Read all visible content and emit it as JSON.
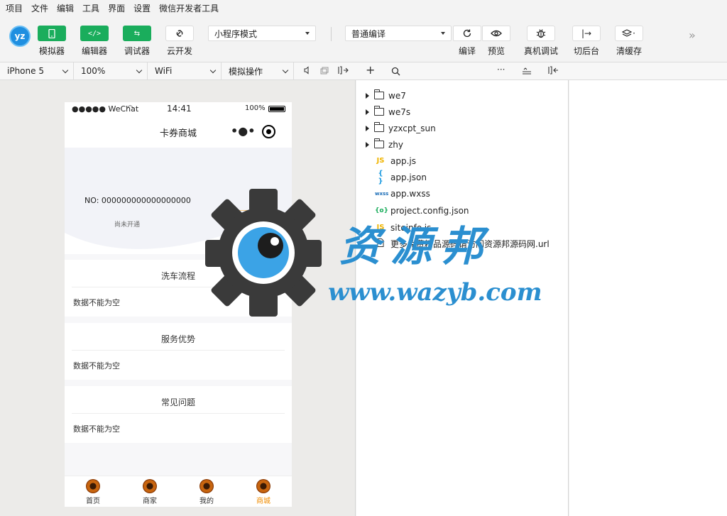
{
  "menu": [
    "项目",
    "文件",
    "编辑",
    "工具",
    "界面",
    "设置",
    "微信开发者工具"
  ],
  "toolbar": {
    "logo": "yz",
    "simulator": "模拟器",
    "editor": "编辑器",
    "debugger": "调试器",
    "cloud": "云开发",
    "mode_select": "小程序模式",
    "compile_select": "普通编译",
    "compile": "编译",
    "preview": "预览",
    "remote_debug": "真机调试",
    "background": "切后台",
    "clear_cache": "清缓存"
  },
  "subbar": {
    "device": "iPhone 5",
    "zoom": "100%",
    "network": "WiFi",
    "operation": "模拟操作"
  },
  "phone": {
    "carrier": "●●●●● WeChat",
    "time": "14:41",
    "battery": "100%",
    "nav_title": "卡券商城",
    "card_no": "NO: 000000000000000000",
    "card_status": "尚未开通",
    "sections": [
      {
        "title": "洗车流程",
        "body": "数据不能为空"
      },
      {
        "title": "服务优势",
        "body": "数据不能为空"
      },
      {
        "title": "常见问题",
        "body": "数据不能为空"
      }
    ],
    "tabs": [
      {
        "label": "首页",
        "active": false
      },
      {
        "label": "商家",
        "active": false
      },
      {
        "label": "我的",
        "active": false
      },
      {
        "label": "商城",
        "active": true
      }
    ],
    "active_tab_color": "#f08c00"
  },
  "tree": [
    {
      "type": "folder",
      "name": "we7"
    },
    {
      "type": "folder",
      "name": "we7s"
    },
    {
      "type": "folder",
      "name": "yzxcpt_sun"
    },
    {
      "type": "folder",
      "name": "zhy"
    },
    {
      "type": "js",
      "icon": "JS",
      "name": "app.js"
    },
    {
      "type": "json",
      "icon": "{ }",
      "name": "app.json"
    },
    {
      "type": "wxss",
      "icon": "wxss",
      "name": "app.wxss"
    },
    {
      "type": "config",
      "icon": "{o}",
      "name": "project.config.json"
    },
    {
      "type": "js",
      "icon": "JS",
      "name": "siteinfo.js"
    },
    {
      "type": "file",
      "icon": "",
      "name": "更多免费精品源码请访问资源邦源码网.url"
    }
  ],
  "watermark": {
    "cn": "资源邦",
    "url": "www.wazyb.com"
  },
  "colors": {
    "green": "#1aad5c",
    "js_icon": "#f0b400",
    "json_icon": "#1e9be0",
    "config_icon": "#1aad5c",
    "wxss_icon": "#1e6fb8",
    "watermark_blue": "#2b8fd0"
  }
}
